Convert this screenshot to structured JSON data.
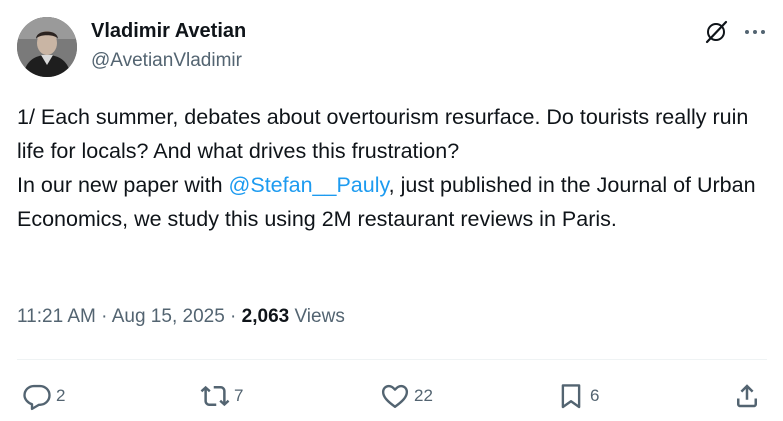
{
  "author": {
    "name": "Vladimir Avetian",
    "handle": "@AvetianVladimir"
  },
  "tweet": {
    "line1": "1/ Each summer, debates about overtourism resurface. Do tourists really ruin life for locals? And what drives this frustration?",
    "line2_prefix": "In our new paper with ",
    "mention": "@Stefan__Pauly",
    "line2_suffix": ", just published in the Journal of Urban Economics, we study this using 2M restaurant reviews in Paris."
  },
  "meta": {
    "time": "11:21 AM",
    "sep1": " · ",
    "date": "Aug 15, 2025",
    "sep2": " · ",
    "views_count": "2,063",
    "views_label": " Views"
  },
  "actions": {
    "replies": "2",
    "reposts": "7",
    "likes": "22",
    "bookmarks": "6"
  },
  "icons": {
    "header": [
      "grok-icon",
      "more-icon"
    ],
    "actions": [
      "reply-icon",
      "repost-icon",
      "like-icon",
      "bookmark-icon",
      "share-icon"
    ]
  },
  "colors": {
    "text": "#0f1419",
    "secondary": "#536471",
    "link": "#1d9bf0",
    "divider": "#eff3f4"
  }
}
